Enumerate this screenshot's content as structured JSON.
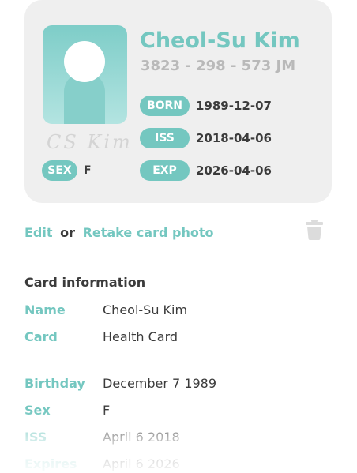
{
  "card": {
    "name": "Cheol-Su Kim",
    "number": "3823 - 298 - 573 JM",
    "signature": "CS Kim",
    "sex_label": "SEX",
    "sex_value": "F",
    "fields": [
      {
        "label": "BORN",
        "value": "1989-12-07"
      },
      {
        "label": "ISS",
        "value": "2018-04-06"
      },
      {
        "label": "EXP",
        "value": "2026-04-06"
      }
    ]
  },
  "actions": {
    "edit_label": "Edit",
    "or_label": "or",
    "retake_label": "Retake card photo"
  },
  "info": {
    "title": "Card information",
    "rows": [
      {
        "label": "Name",
        "value": "Cheol-Su Kim"
      },
      {
        "label": "Card",
        "value": "Health Card"
      },
      {
        "label": "Birthday",
        "value": "December 7 1989"
      },
      {
        "label": "Sex",
        "value": "F"
      },
      {
        "label": "ISS",
        "value": "April 6 2018"
      },
      {
        "label": "Expires",
        "value": "April 6 2026"
      }
    ]
  },
  "icons": {
    "trash": "trash-icon",
    "photo": "person-placeholder-icon"
  },
  "colors": {
    "accent": "#74c7c0",
    "card_bg": "#efefef",
    "text": "#3b3b3b",
    "muted": "#b9b9b9"
  }
}
